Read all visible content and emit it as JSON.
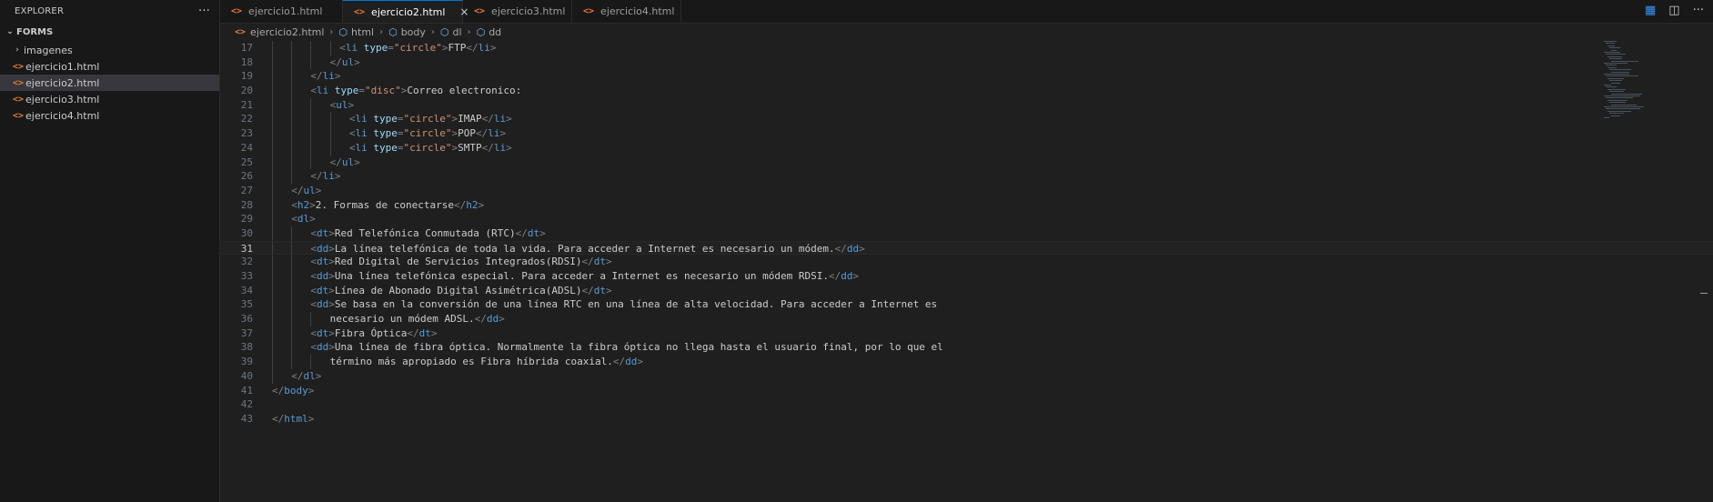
{
  "explorer": {
    "title": "EXPLORER",
    "more_icon": "ellipsis-icon",
    "section": "FORMS",
    "items": [
      {
        "label": "imagenes",
        "type": "folder"
      },
      {
        "label": "ejercicio1.html",
        "type": "file"
      },
      {
        "label": "ejercicio2.html",
        "type": "file",
        "active": true
      },
      {
        "label": "ejercicio3.html",
        "type": "file"
      },
      {
        "label": "ejercicio4.html",
        "type": "file"
      }
    ]
  },
  "tabs": [
    {
      "label": "ejercicio1.html"
    },
    {
      "label": "ejercicio2.html",
      "active": true
    },
    {
      "label": "ejercicio3.html"
    },
    {
      "label": "ejercicio4.html"
    }
  ],
  "breadcrumb": [
    "ejercicio2.html",
    "html",
    "body",
    "dl",
    "dd"
  ],
  "editor": {
    "current_line": "31",
    "lines": [
      {
        "n": "17",
        "indent": 7,
        "tokens": [
          [
            "b",
            "<"
          ],
          [
            "t",
            "li"
          ],
          [
            "a",
            " type"
          ],
          [
            "b",
            "="
          ],
          [
            "s",
            "\"circle\""
          ],
          [
            "b",
            ">"
          ],
          [
            "x",
            "FTP"
          ],
          [
            "b",
            "</"
          ],
          [
            "t",
            "li"
          ],
          [
            "b",
            ">"
          ]
        ]
      },
      {
        "n": "18",
        "indent": 6,
        "tokens": [
          [
            "b",
            "</"
          ],
          [
            "t",
            "ul"
          ],
          [
            "b",
            ">"
          ]
        ]
      },
      {
        "n": "19",
        "indent": 4,
        "tokens": [
          [
            "b",
            "</"
          ],
          [
            "t",
            "li"
          ],
          [
            "b",
            ">"
          ]
        ]
      },
      {
        "n": "20",
        "indent": 4,
        "tokens": [
          [
            "b",
            "<"
          ],
          [
            "t",
            "li"
          ],
          [
            "a",
            " type"
          ],
          [
            "b",
            "="
          ],
          [
            "s",
            "\"disc\""
          ],
          [
            "b",
            ">"
          ],
          [
            "x",
            "Correo electronico:"
          ]
        ]
      },
      {
        "n": "21",
        "indent": 6,
        "tokens": [
          [
            "b",
            "<"
          ],
          [
            "t",
            "ul"
          ],
          [
            "b",
            ">"
          ]
        ]
      },
      {
        "n": "22",
        "indent": 8,
        "tokens": [
          [
            "b",
            "<"
          ],
          [
            "t",
            "li"
          ],
          [
            "a",
            " type"
          ],
          [
            "b",
            "="
          ],
          [
            "s",
            "\"circle\""
          ],
          [
            "b",
            ">"
          ],
          [
            "x",
            "IMAP"
          ],
          [
            "b",
            "</"
          ],
          [
            "t",
            "li"
          ],
          [
            "b",
            ">"
          ]
        ]
      },
      {
        "n": "23",
        "indent": 8,
        "tokens": [
          [
            "b",
            "<"
          ],
          [
            "t",
            "li"
          ],
          [
            "a",
            " type"
          ],
          [
            "b",
            "="
          ],
          [
            "s",
            "\"circle\""
          ],
          [
            "b",
            ">"
          ],
          [
            "x",
            "POP"
          ],
          [
            "b",
            "</"
          ],
          [
            "t",
            "li"
          ],
          [
            "b",
            ">"
          ]
        ]
      },
      {
        "n": "24",
        "indent": 8,
        "tokens": [
          [
            "b",
            "<"
          ],
          [
            "t",
            "li"
          ],
          [
            "a",
            " type"
          ],
          [
            "b",
            "="
          ],
          [
            "s",
            "\"circle\""
          ],
          [
            "b",
            ">"
          ],
          [
            "x",
            "SMTP"
          ],
          [
            "b",
            "</"
          ],
          [
            "t",
            "li"
          ],
          [
            "b",
            ">"
          ]
        ]
      },
      {
        "n": "25",
        "indent": 6,
        "tokens": [
          [
            "b",
            "</"
          ],
          [
            "t",
            "ul"
          ],
          [
            "b",
            ">"
          ]
        ]
      },
      {
        "n": "26",
        "indent": 4,
        "tokens": [
          [
            "b",
            "</"
          ],
          [
            "t",
            "li"
          ],
          [
            "b",
            ">"
          ]
        ]
      },
      {
        "n": "27",
        "indent": 2,
        "tokens": [
          [
            "b",
            "</"
          ],
          [
            "t",
            "ul"
          ],
          [
            "b",
            ">"
          ]
        ]
      },
      {
        "n": "28",
        "indent": 2,
        "tokens": [
          [
            "b",
            "<"
          ],
          [
            "t",
            "h2"
          ],
          [
            "b",
            ">"
          ],
          [
            "x",
            "2. Formas de conectarse"
          ],
          [
            "b",
            "</"
          ],
          [
            "t",
            "h2"
          ],
          [
            "b",
            ">"
          ]
        ]
      },
      {
        "n": "29",
        "indent": 2,
        "tokens": [
          [
            "b",
            "<"
          ],
          [
            "t",
            "dl"
          ],
          [
            "b",
            ">"
          ]
        ]
      },
      {
        "n": "30",
        "indent": 4,
        "tokens": [
          [
            "b",
            "<"
          ],
          [
            "t",
            "dt"
          ],
          [
            "b",
            ">"
          ],
          [
            "x",
            "Red Telefónica Conmutada (RTC)"
          ],
          [
            "b",
            "</"
          ],
          [
            "t",
            "dt"
          ],
          [
            "b",
            ">"
          ]
        ]
      },
      {
        "n": "31",
        "indent": 4,
        "tokens": [
          [
            "b",
            "<"
          ],
          [
            "t",
            "dd"
          ],
          [
            "b",
            ">"
          ],
          [
            "x",
            "La línea telefónica de toda la vida. Para acceder a Internet es necesario un módem."
          ],
          [
            "b",
            "</"
          ],
          [
            "t",
            "dd"
          ],
          [
            "b",
            ">"
          ]
        ]
      },
      {
        "n": "32",
        "indent": 4,
        "tokens": [
          [
            "b",
            "<"
          ],
          [
            "t",
            "dt"
          ],
          [
            "b",
            ">"
          ],
          [
            "x",
            "Red Digital de Servicios Integrados(RDSI)"
          ],
          [
            "b",
            "</"
          ],
          [
            "t",
            "dt"
          ],
          [
            "b",
            ">"
          ]
        ]
      },
      {
        "n": "33",
        "indent": 4,
        "tokens": [
          [
            "b",
            "<"
          ],
          [
            "t",
            "dd"
          ],
          [
            "b",
            ">"
          ],
          [
            "x",
            "Una línea telefónica especial. Para acceder a Internet es necesario un módem RDSI."
          ],
          [
            "b",
            "</"
          ],
          [
            "t",
            "dd"
          ],
          [
            "b",
            ">"
          ]
        ]
      },
      {
        "n": "34",
        "indent": 4,
        "tokens": [
          [
            "b",
            "<"
          ],
          [
            "t",
            "dt"
          ],
          [
            "b",
            ">"
          ],
          [
            "x",
            "Línea de Abonado Digital Asimétrica(ADSL)"
          ],
          [
            "b",
            "</"
          ],
          [
            "t",
            "dt"
          ],
          [
            "b",
            ">"
          ]
        ]
      },
      {
        "n": "35",
        "indent": 4,
        "tokens": [
          [
            "b",
            "<"
          ],
          [
            "t",
            "dd"
          ],
          [
            "b",
            ">"
          ],
          [
            "x",
            "Se basa en la conversión de una línea RTC en una línea de alta velocidad. Para acceder a Internet es"
          ]
        ]
      },
      {
        "n": "36",
        "indent": 6,
        "tokens": [
          [
            "x",
            "necesario un módem ADSL."
          ],
          [
            "b",
            "</"
          ],
          [
            "t",
            "dd"
          ],
          [
            "b",
            ">"
          ]
        ]
      },
      {
        "n": "37",
        "indent": 4,
        "tokens": [
          [
            "b",
            "<"
          ],
          [
            "t",
            "dt"
          ],
          [
            "b",
            ">"
          ],
          [
            "x",
            "Fibra Óptica"
          ],
          [
            "b",
            "</"
          ],
          [
            "t",
            "dt"
          ],
          [
            "b",
            ">"
          ]
        ]
      },
      {
        "n": "38",
        "indent": 4,
        "tokens": [
          [
            "b",
            "<"
          ],
          [
            "t",
            "dd"
          ],
          [
            "b",
            ">"
          ],
          [
            "x",
            "Una línea de fibra óptica. Normalmente la fibra óptica no llega hasta el usuario final, por lo que el"
          ]
        ]
      },
      {
        "n": "39",
        "indent": 6,
        "tokens": [
          [
            "x",
            "término más apropiado es Fibra híbrida coaxial."
          ],
          [
            "b",
            "</"
          ],
          [
            "t",
            "dd"
          ],
          [
            "b",
            ">"
          ]
        ]
      },
      {
        "n": "40",
        "indent": 2,
        "tokens": [
          [
            "b",
            "</"
          ],
          [
            "t",
            "dl"
          ],
          [
            "b",
            ">"
          ]
        ]
      },
      {
        "n": "41",
        "indent": 0,
        "tokens": [
          [
            "b",
            "</"
          ],
          [
            "t",
            "body"
          ],
          [
            "b",
            ">"
          ]
        ]
      },
      {
        "n": "42",
        "indent": 0,
        "tokens": []
      },
      {
        "n": "43",
        "indent": 0,
        "tokens": [
          [
            "b",
            "</"
          ],
          [
            "t",
            "html"
          ],
          [
            "b",
            ">"
          ]
        ]
      }
    ]
  },
  "colors": {
    "accent": "#0078d4",
    "tag": "#569cd6",
    "attribute": "#9cdcfe",
    "string": "#ce9178",
    "html_file_icon": "#e37933"
  }
}
